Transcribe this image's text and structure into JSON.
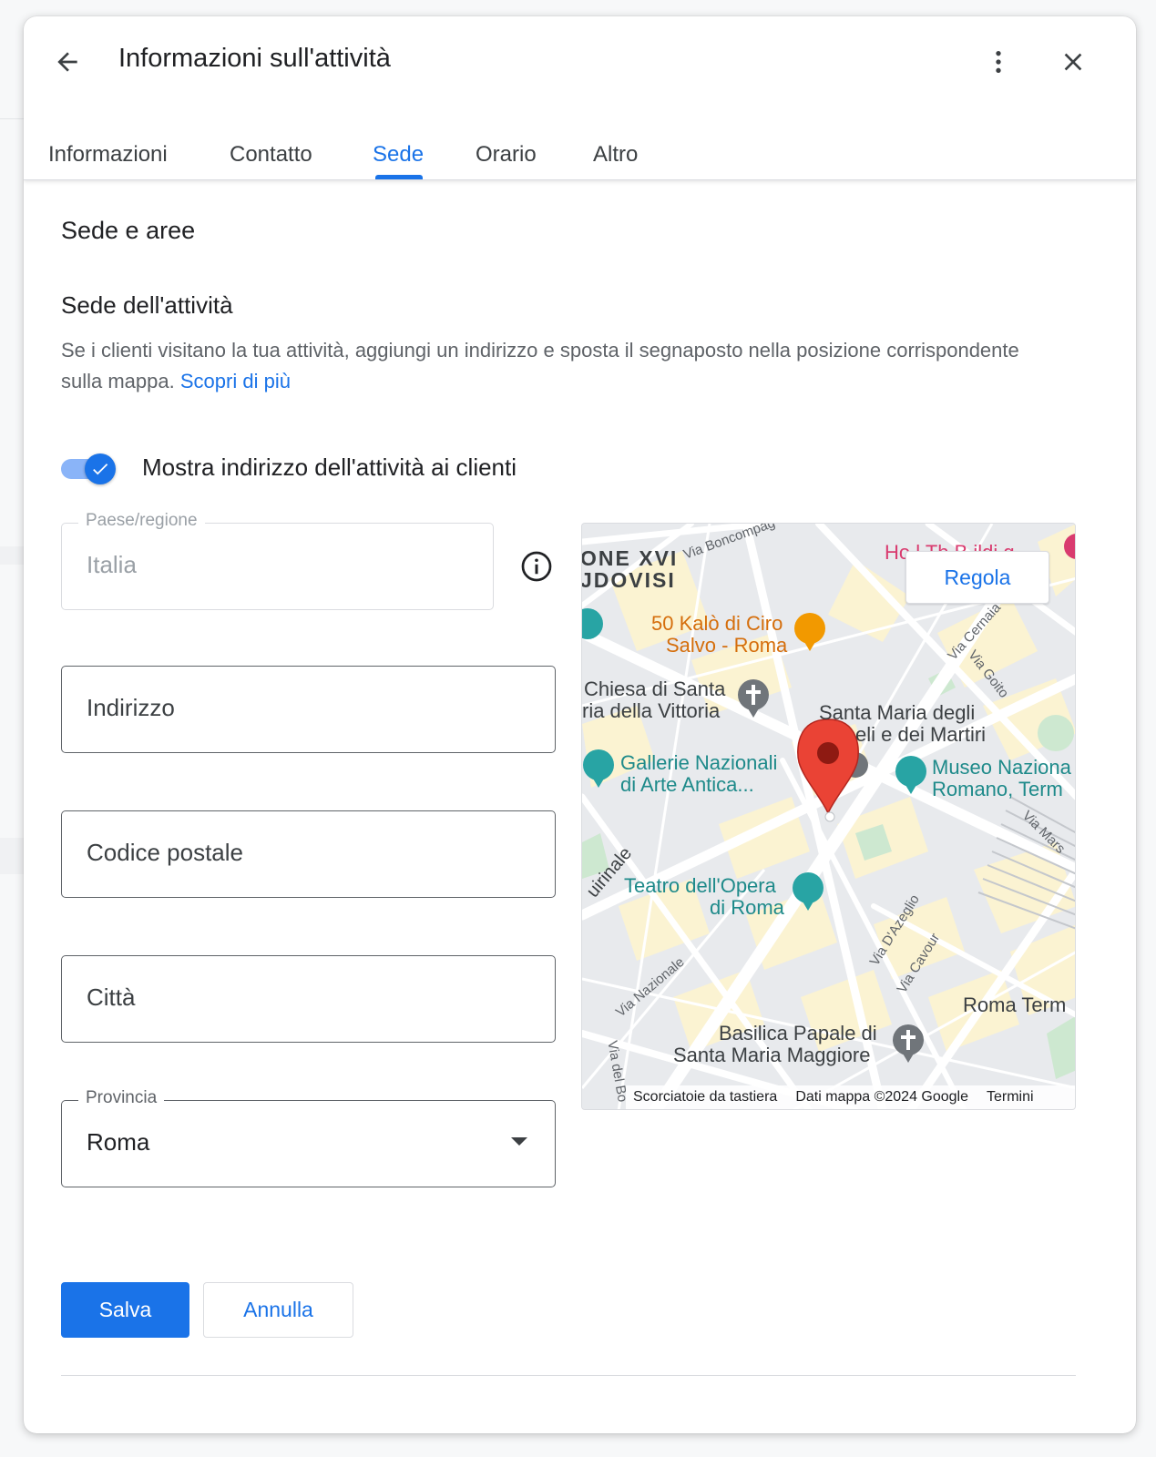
{
  "dialog": {
    "title": "Informazioni sull'attività",
    "back_icon": "arrow-back-icon",
    "more_icon": "more-vert-icon",
    "close_icon": "close-icon"
  },
  "tabs": [
    {
      "label": "Informazioni",
      "active": false
    },
    {
      "label": "Contatto",
      "active": false
    },
    {
      "label": "Sede",
      "active": true
    },
    {
      "label": "Orario",
      "active": false
    },
    {
      "label": "Altro",
      "active": false
    }
  ],
  "section": {
    "title": "Sede e aree",
    "subtitle": "Sede dell'attività",
    "description": "Se i clienti visitano la tua attività, aggiungi un indirizzo e sposta il segnaposto nella posizione corrispondente sulla mappa.",
    "learn_more": "Scopri di più"
  },
  "toggle": {
    "label": "Mostra indirizzo dell'attività ai clienti",
    "checked": true
  },
  "form": {
    "country": {
      "label": "Paese/regione",
      "value": "Italia",
      "disabled": true
    },
    "address": {
      "placeholder": "Indirizzo"
    },
    "postal_code": {
      "placeholder": "Codice postale"
    },
    "city": {
      "placeholder": "Città"
    },
    "province": {
      "label": "Provincia",
      "value": "Roma"
    }
  },
  "map": {
    "adjust_button": "Regola",
    "labels": {
      "district_1": "ONE XVI",
      "district_2": "JDOVISI",
      "street_boncompagni": "Via Boncompag",
      "hotel": "Ho   l Th  B  ildi  g",
      "restaurant_1": "50 Kalò di Ciro",
      "restaurant_2": "Salvo - Roma",
      "church_1": "Chiesa di Santa",
      "church_2": "ria della Vittoria",
      "basilica_angeli_1": "Santa Maria degli",
      "basilica_angeli_2": "eli e dei Martiri",
      "gallery_1": "Gallerie Nazionali",
      "gallery_2": "di Arte Antica...",
      "museum_1": "Museo Naziona",
      "museum_2": "Romano, Term",
      "quirinale": "uirinale",
      "theatre_1": "Teatro dell'Opera",
      "theatre_2": "di Roma",
      "via_cernaia": "Via Cernaia",
      "via_goito": "Via Goito",
      "via_mars": "Via Mars",
      "via_dazeglio": "Via D'Azeglio",
      "via_cavour": "Via Cavour",
      "via_nazionale": "Via Nazionale",
      "via_del": "Via del Bo",
      "roma_termini": "Roma Term",
      "basilica_1": "Basilica Papale di",
      "basilica_2": "Santa Maria Maggiore"
    },
    "footer": {
      "shortcuts": "Scorciatoie da tastiera",
      "data": "Dati mappa ©2024 Google",
      "terms": "Termini"
    },
    "pin_color": "#d9473b"
  },
  "actions": {
    "save": "Salva",
    "cancel": "Annulla"
  },
  "colors": {
    "accent": "#1a73e8"
  }
}
